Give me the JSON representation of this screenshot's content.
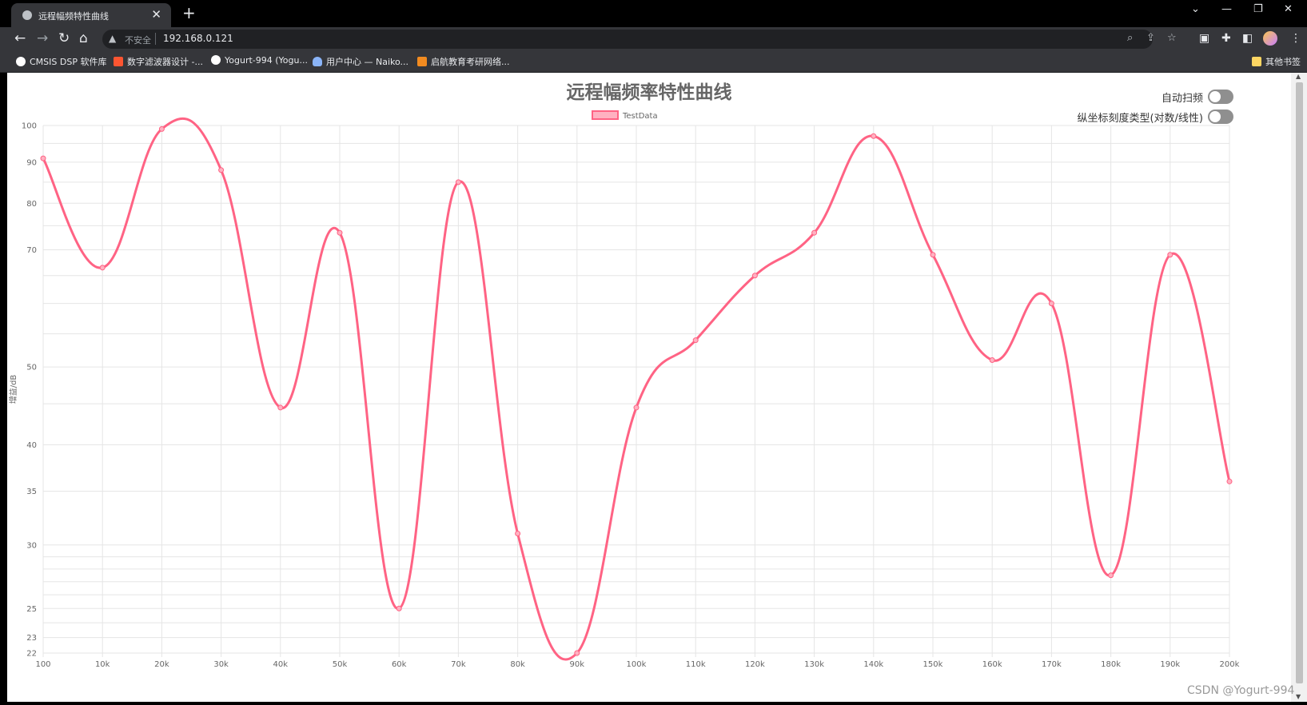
{
  "browser": {
    "tab_title": "远程幅频特性曲线",
    "tab_close": "✕",
    "new_tab": "+",
    "security_label": "不安全",
    "url": "192.168.0.121",
    "bookmarks": [
      {
        "label": "CMSIS DSP 软件库",
        "icon_color": "#ffffff"
      },
      {
        "label": "数字滤波器设计 -...",
        "icon_color": "#fc5531"
      },
      {
        "label": "Yogurt-994 (Yogu...",
        "icon_color": "#ffffff"
      },
      {
        "label": "用户中心 — Naiko...",
        "icon_color": "#8ab4f8"
      },
      {
        "label": "启航教育考研网络...",
        "icon_color": "#f28b20"
      }
    ],
    "other_bookmarks": "其他书签"
  },
  "page": {
    "title": "远程幅频率特性曲线",
    "toggle_auto_sweep": {
      "label": "自动扫频",
      "on": false
    },
    "toggle_scale_type": {
      "label": "纵坐标刻度类型(对数/线性)",
      "on": false
    }
  },
  "watermark": "CSDN @Yogurt-994",
  "colors": {
    "series": "#ff6384",
    "legend_fill": "#ffb1c1",
    "grid": "#e5e5e5",
    "text": "#666666"
  },
  "chart_data": {
    "type": "line",
    "title": "远程幅频率特性曲线",
    "ylabel": "增益/dB",
    "xlabel": "",
    "yscale": "log",
    "ylim": [
      22,
      100
    ],
    "grid": true,
    "legend_position": "top",
    "categories": [
      "100",
      "10k",
      "20k",
      "30k",
      "40k",
      "50k",
      "60k",
      "70k",
      "80k",
      "90k",
      "100k",
      "110k",
      "120k",
      "130k",
      "140k",
      "150k",
      "160k",
      "170k",
      "180k",
      "190k",
      "200k"
    ],
    "series": [
      {
        "name": "TestData",
        "values": [
          91,
          66.5,
          99,
          88,
          44.5,
          73.5,
          25,
          85,
          31,
          22,
          44.5,
          54,
          65,
          73.5,
          97,
          69,
          51,
          60,
          27.5,
          69,
          36
        ]
      }
    ],
    "y_ticks": [
      100,
      90,
      80,
      70,
      50,
      40,
      35,
      30,
      25,
      23,
      22
    ],
    "x_tick_labels": [
      "100",
      "10k",
      "20k",
      "30k",
      "40k",
      "50k",
      "60k",
      "70k",
      "80k",
      "90k",
      "100k",
      "110k",
      "120k",
      "130k",
      "140k",
      "150k",
      "160k",
      "170k",
      "180k",
      "190k",
      "200k"
    ]
  }
}
